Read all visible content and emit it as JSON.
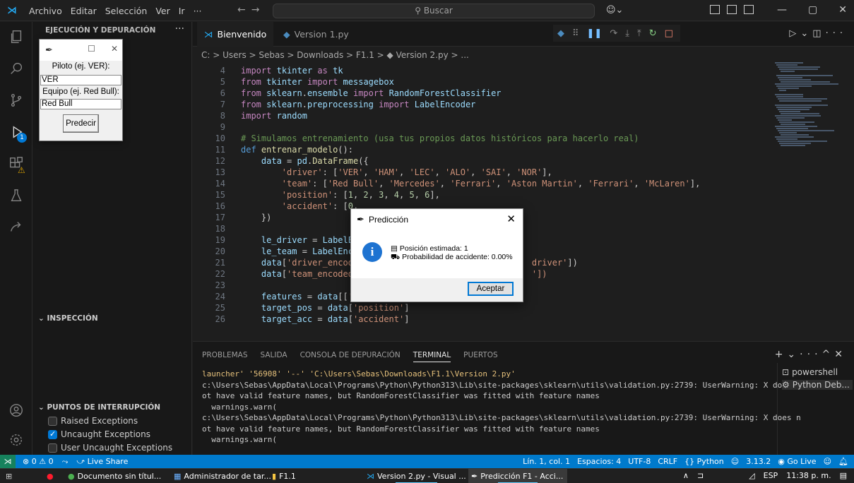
{
  "titlebar": {
    "menu": [
      "Archivo",
      "Editar",
      "Selección",
      "Ver",
      "Ir",
      "···"
    ],
    "search_placeholder": "Buscar"
  },
  "sidebar": {
    "header": "EJECUCIÓN Y DEPURACIÓN",
    "inspection": "INSPECCIÓN",
    "breakpoints": "PUNTOS DE INTERRUPCIÓN",
    "bp_items": [
      {
        "label": "Raised Exceptions",
        "checked": false
      },
      {
        "label": "Uncaught Exceptions",
        "checked": true
      },
      {
        "label": "User Uncaught Exceptions",
        "checked": false
      }
    ]
  },
  "tkwin": {
    "label_pilot": "Piloto (ej. VER):",
    "pilot_value": "VER",
    "label_team": "Equipo (ej. Red Bull):",
    "team_value": "Red Bull",
    "button": "Predecir"
  },
  "tabs": [
    {
      "label": "Bienvenido",
      "active": false
    },
    {
      "label": "Version 1.py",
      "active": false
    }
  ],
  "breadcrumb": "C: > Users > Sebas > Downloads > F1.1 > ◆ Version 2.py > ...",
  "code": [
    {
      "n": "4",
      "t": "import tkinter as tk"
    },
    {
      "n": "5",
      "t": "from tkinter import messagebox"
    },
    {
      "n": "6",
      "t": "from sklearn.ensemble import RandomForestClassifier"
    },
    {
      "n": "7",
      "t": "from sklearn.preprocessing import LabelEncoder"
    },
    {
      "n": "8",
      "t": "import random"
    },
    {
      "n": "9",
      "t": ""
    },
    {
      "n": "10",
      "t": "# Simulamos entrenamiento (usa tus propios datos históricos para hacerlo real)"
    },
    {
      "n": "11",
      "t": "def entrenar_modelo():"
    },
    {
      "n": "12",
      "t": "    data = pd.DataFrame({"
    },
    {
      "n": "13",
      "t": "        'driver': ['VER', 'HAM', 'LEC', 'ALO', 'SAI', 'NOR'],"
    },
    {
      "n": "14",
      "t": "        'team': ['Red Bull', 'Mercedes', 'Ferrari', 'Aston Martin', 'Ferrari', 'McLaren'],"
    },
    {
      "n": "15",
      "t": "        'position': [1, 2, 3, 4, 5, 6],"
    },
    {
      "n": "16",
      "t": "        'accident': [0,"
    },
    {
      "n": "17",
      "t": "    })"
    },
    {
      "n": "18",
      "t": ""
    },
    {
      "n": "19",
      "t": "    le_driver = LabelEn"
    },
    {
      "n": "20",
      "t": "    le_team = LabelEnco"
    },
    {
      "n": "21",
      "t": "    data['driver_encode                                  driver'])"
    },
    {
      "n": "22",
      "t": "    data['team_encoded'                                  '])"
    },
    {
      "n": "23",
      "t": ""
    },
    {
      "n": "24",
      "t": "    features = data[['driver_encoded', 'team_encoded']]"
    },
    {
      "n": "25",
      "t": "    target_pos = data['position']"
    },
    {
      "n": "26",
      "t": "    target_acc = data['accident']"
    }
  ],
  "panel": {
    "tabs": [
      "PROBLEMAS",
      "SALIDA",
      "CONSOLA DE DEPURACIÓN",
      "TERMINAL",
      "PUERTOS"
    ],
    "active_tab": "TERMINAL",
    "terminal_lines": [
      "launcher' '56908' '--' 'C:\\Users\\Sebas\\Downloads\\F1.1\\Version 2.py'",
      "c:\\Users\\Sebas\\AppData\\Local\\Programs\\Python\\Python313\\Lib\\site-packages\\sklearn\\utils\\validation.py:2739: UserWarning: X does n",
      "ot have valid feature names, but RandomForestClassifier was fitted with feature names",
      "  warnings.warn(",
      "c:\\Users\\Sebas\\AppData\\Local\\Programs\\Python\\Python313\\Lib\\site-packages\\sklearn\\utils\\validation.py:2739: UserWarning: X does n",
      "ot have valid feature names, but RandomForestClassifier was fitted with feature names",
      "  warnings.warn("
    ],
    "terminals": [
      "powershell",
      "Python Deb..."
    ]
  },
  "statusbar": {
    "problems": "⊗ 0 ⚠ 0",
    "live_share": "Live Share",
    "position": "Lín. 1, col. 1",
    "spaces": "Espacios: 4",
    "encoding": "UTF-8",
    "eol": "CRLF",
    "language": "{} Python",
    "python_version": "3.13.2",
    "go_live": "Go Live"
  },
  "taskbar": {
    "items": [
      "Documento sin títul...",
      "Administrador de tar...",
      "F1.1",
      "Version 2.py - Visual ...",
      "Predicción F1 - Acci..."
    ],
    "lang": "ESP",
    "time": "11:38 p. m."
  },
  "msgbox": {
    "title": "Predicción",
    "line1": "Posición estimada: 1",
    "line2": "Probabilidad de accidente: 0.00%",
    "button": "Aceptar"
  }
}
